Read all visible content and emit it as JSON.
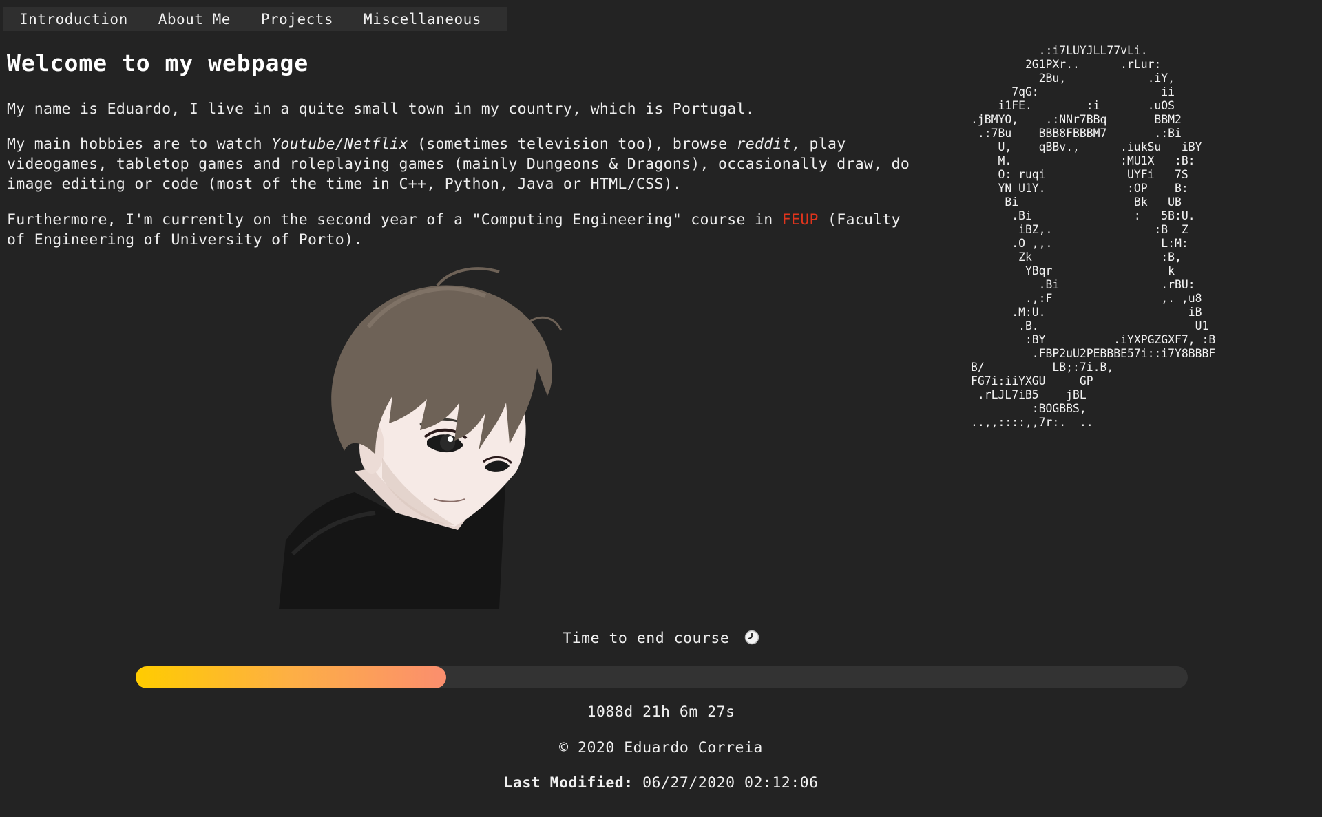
{
  "nav": {
    "items": [
      {
        "label": "Introduction"
      },
      {
        "label": "About Me"
      },
      {
        "label": "Projects"
      },
      {
        "label": "Miscellaneous"
      }
    ]
  },
  "main": {
    "title": "Welcome to my webpage",
    "p1": "My name is Eduardo, I live in a quite small town in my country, which is Portugal.",
    "p2": {
      "a": "My main hobbies are to watch ",
      "youtube": "Youtube/Netflix",
      "b": " (sometimes television too), browse ",
      "reddit": "reddit",
      "c": ", play videogames, tabletop games and roleplaying games (mainly Dungeons & Dragons), occasionally draw, do image editing or code (most of the time in C++, Python, Java or HTML/CSS)."
    },
    "p3": {
      "a": "Furthermore, I'm currently on the second year of a \"Computing Engineering\" course in ",
      "link": "FEUP",
      "b": " (Faculty of Engineering of University of Porto)."
    }
  },
  "ascii_art": "          .:i7LUYJLL77vLi.\n        2G1PXr..      .rLur:\n          2Bu,            .iY,\n      7qG:                  ii\n    i1FE.        :i       .uOS\n.jBMYO,    .:NNr7BBq       BBM2\n .:7Bu    BBB8FBBBM7       .:Bi\n    U,    qBBv.,      .iukSu   iBY\n    M.                :MU1X   :B:\n    O: ruqi            UYFi   7S\n    YN U1Y.            :OP    B:\n     Bi                 Bk   UB\n      .Bi               :   5B:U.\n       iBZ,.               :B  Z\n      .O ,,.                L:M:\n       Zk                   :B,\n        YBqr                 k\n          .Bi               .rBU:\n        .,:F                ,. ,u8\n      .M:U.                     iB\n       .B.                       U1\n        :BY          .iYXPGZGXF7, :B\n         .FBP2uU2PEBBBE57i::i7Y8BBBF\nB/          LB;:7i.B,\nFG7i:iiYXGU     GP\n .rLJL7iB5    jBL\n         :BOGBBS,\n..,,::::,,7r:.  ..",
  "timer": {
    "label": "Time to end course",
    "icon": "clock-icon",
    "progress_fraction": 0.295,
    "countdown": "1088d 21h 6m 27s"
  },
  "footer": {
    "copyright": "© 2020 Eduardo Correia",
    "modified_label": "Last Modified:",
    "modified_value": "06/27/2020 02:12:06"
  },
  "colors": {
    "background": "#232323",
    "link": "#e0341c",
    "progress_start": "#ffcc00",
    "progress_end": "#fb8e6e"
  }
}
